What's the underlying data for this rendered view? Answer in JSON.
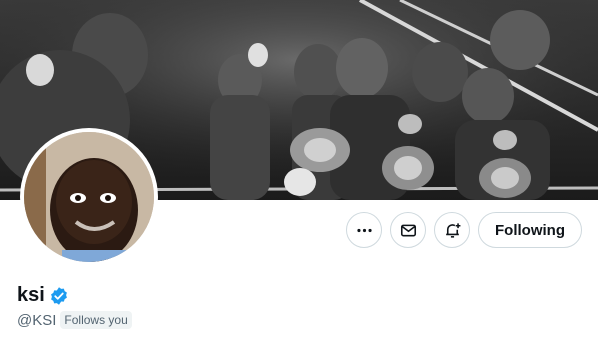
{
  "profile": {
    "display_name": "ksi",
    "handle": "@KSI",
    "follows_you": "Follows you",
    "verified": true
  },
  "actions": {
    "more_icon": "more-horizontal-icon",
    "message_icon": "envelope-icon",
    "notify_icon": "bell-plus-icon",
    "follow_label": "Following"
  },
  "colors": {
    "accent": "#1d9bf0",
    "border": "#cfd9de",
    "text_primary": "#0f1419",
    "text_secondary": "#536471",
    "badge_bg": "#eff3f4"
  }
}
